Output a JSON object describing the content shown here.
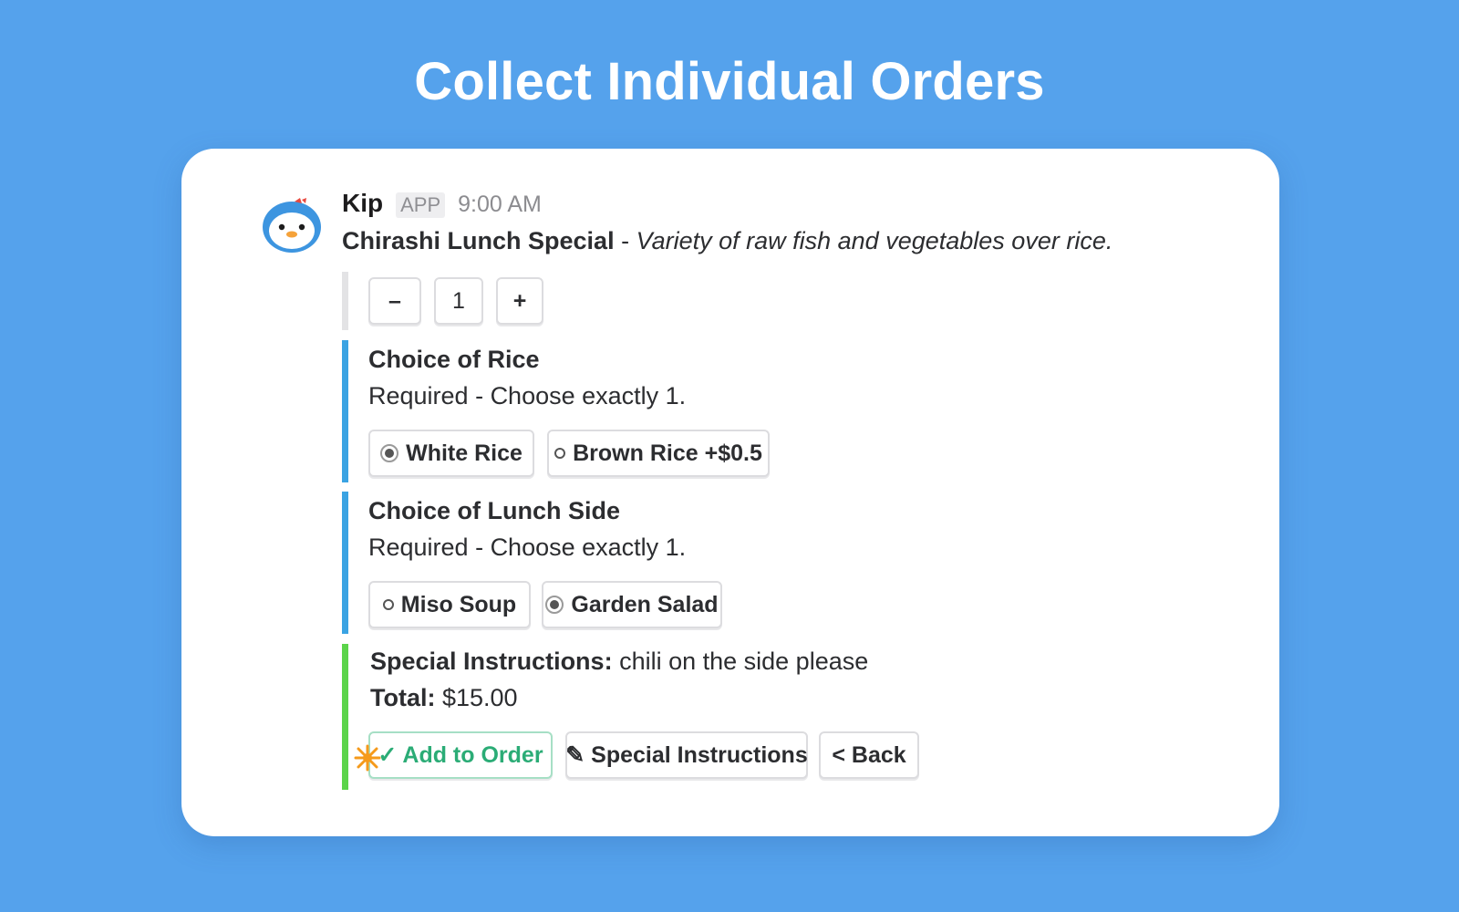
{
  "headline": "Collect Individual Orders",
  "message": {
    "sender": "Kip",
    "badge": "APP",
    "time": "9:00 AM",
    "item_name": "Chirashi Lunch Special",
    "separator": " - ",
    "item_description": "Variety of raw fish and vegetables over rice."
  },
  "quantity": {
    "decrement_label": "–",
    "value": "1",
    "increment_label": "+"
  },
  "rice": {
    "title": "Choice of Rice",
    "subtitle": "Required - Choose exactly 1.",
    "options": [
      {
        "label": "White Rice",
        "selected": true
      },
      {
        "label": "Brown Rice +$0.5",
        "selected": false
      }
    ]
  },
  "side": {
    "title": "Choice of Lunch Side",
    "subtitle": "Required - Choose exactly 1.",
    "options": [
      {
        "label": "Miso Soup",
        "selected": false
      },
      {
        "label": "Garden Salad",
        "selected": true
      }
    ]
  },
  "summary": {
    "instructions_label": "Special Instructions:",
    "instructions_value": " chili on the side please",
    "total_label": "Total:",
    "total_value": " $15.00"
  },
  "actions": {
    "add_label": "✓ Add to Order",
    "instructions_label": "✎ Special Instructions",
    "back_label": "< Back"
  },
  "colors": {
    "background": "#55a2ec",
    "accent_blue": "#3aa3e3",
    "accent_green": "#5bd44a",
    "add_green": "#2bac76"
  }
}
